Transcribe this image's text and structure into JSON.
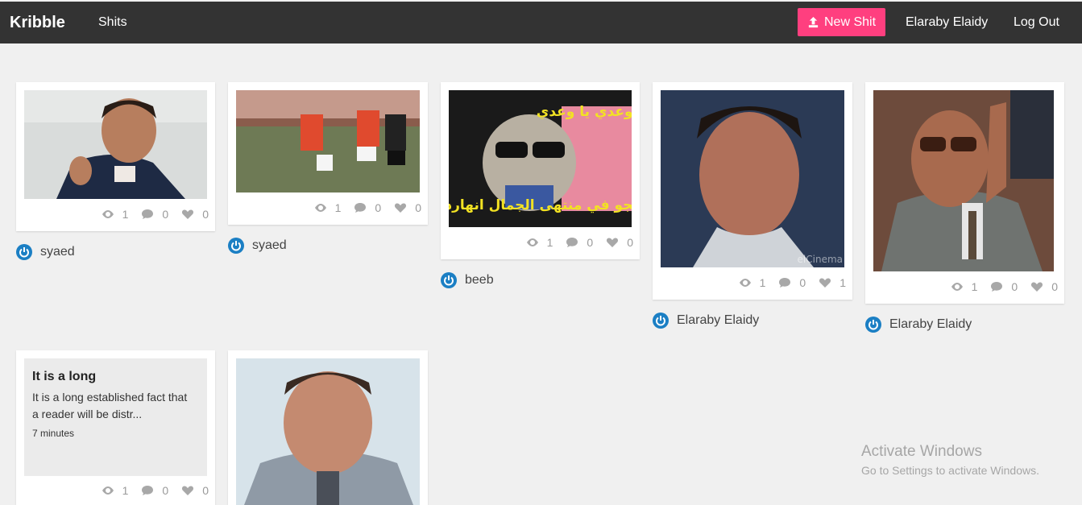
{
  "nav": {
    "brand": "Kribble",
    "shits_link": "Shits",
    "new_button": "New Shit",
    "user_name": "Elaraby Elaidy",
    "logout": "Log Out"
  },
  "posts": [
    {
      "author": "syaed",
      "views": "1",
      "comments": "0",
      "likes": "0"
    },
    {
      "author": "syaed",
      "views": "1",
      "comments": "0",
      "likes": "0"
    },
    {
      "author": "beeb",
      "views": "1",
      "comments": "0",
      "likes": "0",
      "image_text_top": "يا وعدي يا وعدي",
      "image_text_bottom": "الجو في منتهى الجمال انهارده"
    },
    {
      "author": "Elaraby Elaidy",
      "views": "1",
      "comments": "0",
      "likes": "1",
      "image_watermark": "elCinema"
    },
    {
      "author": "Elaraby Elaidy",
      "views": "1",
      "comments": "0",
      "likes": "0"
    },
    {
      "title": "It is a long",
      "excerpt_line1": "It is a long established fact that",
      "excerpt_line2": "a reader will be distr...",
      "read_time": "7 minutes",
      "views": "1",
      "comments": "0",
      "likes": "0"
    }
  ],
  "os_overlay": {
    "line1": "Activate Windows",
    "line2": "Go to Settings to activate Windows."
  },
  "colors": {
    "navbar": "#333333",
    "accent": "#ff3f7f",
    "user_icon": "#1b7fc4",
    "background": "#f0f0f0"
  }
}
